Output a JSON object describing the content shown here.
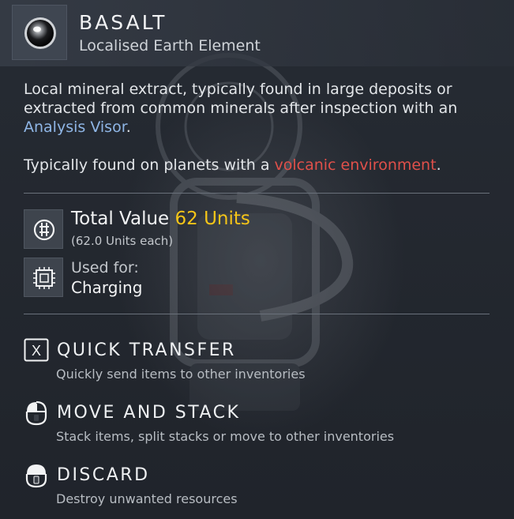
{
  "item": {
    "name": "BASALT",
    "category": "Localised Earth Element",
    "icon": "basalt-orb-icon"
  },
  "description": {
    "line1_prefix": "Local mineral extract, typically found in large deposits or extracted from common minerals after inspection with an ",
    "line1_link": "Analysis Visor",
    "line1_suffix": ".",
    "line2_prefix": "Typically found on planets with a ",
    "line2_link": "volcanic environment",
    "line2_suffix": "."
  },
  "value": {
    "label": "Total Value",
    "amount": "62 Units",
    "each": "(62.0 Units each)",
    "icon": "units-currency-icon"
  },
  "usage": {
    "label": "Used for:",
    "value": "Charging",
    "icon": "chip-icon"
  },
  "actions": [
    {
      "name": "QUICK TRANSFER",
      "hint": "Quickly send items to other inventories",
      "icon": "x-button-icon"
    },
    {
      "name": "MOVE AND STACK",
      "hint": "Stack items, split stacks or move to other inventories",
      "icon": "mouse-left-icon"
    },
    {
      "name": "DISCARD",
      "hint": "Destroy unwanted resources",
      "icon": "mouse-hold-icon"
    }
  ],
  "colors": {
    "accent_yellow": "#f5c518",
    "link_blue": "#8fb6e6",
    "link_red": "#e0504a",
    "panel_bg": "#20242b"
  }
}
